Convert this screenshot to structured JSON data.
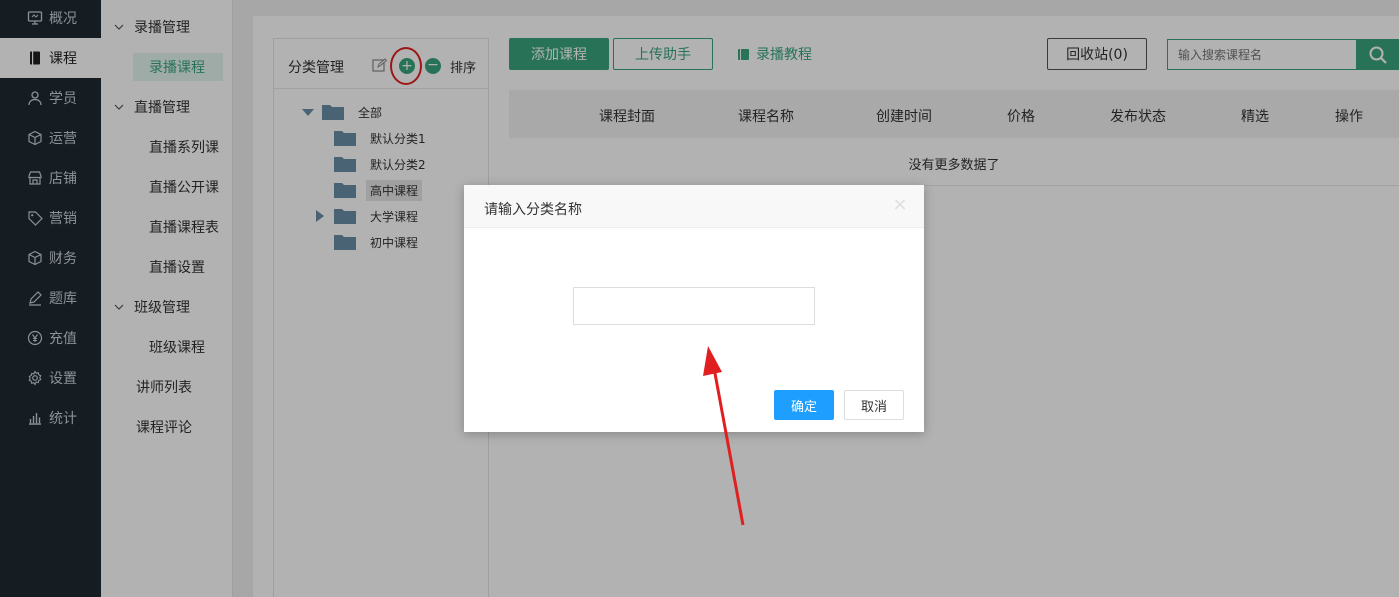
{
  "nav": {
    "items": [
      {
        "label": "概况",
        "icon": "monitor-icon"
      },
      {
        "label": "课程",
        "icon": "book-icon"
      },
      {
        "label": "学员",
        "icon": "user-icon"
      },
      {
        "label": "运营",
        "icon": "cube-icon"
      },
      {
        "label": "店铺",
        "icon": "store-icon"
      },
      {
        "label": "营销",
        "icon": "tag-icon"
      },
      {
        "label": "财务",
        "icon": "cube-icon"
      },
      {
        "label": "题库",
        "icon": "pen-icon"
      },
      {
        "label": "充值",
        "icon": "yen-icon"
      },
      {
        "label": "设置",
        "icon": "gear-icon"
      },
      {
        "label": "统计",
        "icon": "bar-chart-icon"
      }
    ],
    "active": "课程"
  },
  "submenu": {
    "group_recorded": "录播管理",
    "recorded_course": "录播课程",
    "group_live": "直播管理",
    "live_series": "直播系列课",
    "live_open": "直播公开课",
    "live_schedule": "直播课程表",
    "live_settings": "直播设置",
    "group_class": "班级管理",
    "class_course": "班级课程",
    "lecturer_list": "讲师列表",
    "course_review": "课程评论"
  },
  "category": {
    "title": "分类管理",
    "sort_label": "排序",
    "add_symbol": "+",
    "minus_symbol": "−",
    "tree": {
      "root": "全部",
      "items": [
        "默认分类1",
        "默认分类2",
        "高中课程",
        "大学课程",
        "初中课程"
      ],
      "selected": "高中课程"
    }
  },
  "toolbar": {
    "add_course": "添加课程",
    "upload_helper": "上传助手",
    "tutorial": "录播教程",
    "recycle": "回收站(0)",
    "search_placeholder": "输入搜索课程名"
  },
  "table": {
    "headers": [
      "课程封面",
      "课程名称",
      "创建时间",
      "价格",
      "发布状态",
      "精选",
      "操作"
    ],
    "empty_text": "没有更多数据了"
  },
  "dialog": {
    "title": "请输入分类名称",
    "close": "×",
    "input_value": "",
    "ok_label": "确定",
    "cancel_label": "取消"
  },
  "colors": {
    "nav_bg": "#1f2a33",
    "brand_green": "#3aa57e",
    "dialog_ok": "#1e9fff",
    "annotation_red": "#e02020"
  }
}
